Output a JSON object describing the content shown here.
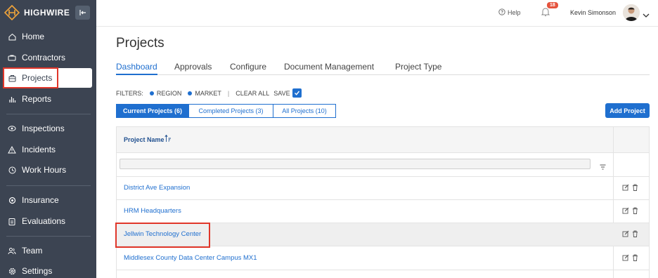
{
  "app": {
    "brand": "HIGHWIRE"
  },
  "sidebar": {
    "items": [
      {
        "label": "Home",
        "icon": "home-icon"
      },
      {
        "label": "Contractors",
        "icon": "contractors-icon"
      },
      {
        "label": "Projects",
        "icon": "projects-icon",
        "active": true
      },
      {
        "label": "Reports",
        "icon": "reports-icon"
      },
      {
        "label": "Inspections",
        "icon": "inspections-icon"
      },
      {
        "label": "Incidents",
        "icon": "incidents-icon"
      },
      {
        "label": "Work Hours",
        "icon": "work-hours-icon"
      },
      {
        "label": "Insurance",
        "icon": "insurance-icon"
      },
      {
        "label": "Evaluations",
        "icon": "evaluations-icon"
      },
      {
        "label": "Team",
        "icon": "team-icon"
      },
      {
        "label": "Settings",
        "icon": "settings-icon"
      }
    ]
  },
  "topbar": {
    "help_label": "Help",
    "notification_count": "18",
    "user_name": "Kevin Simonson"
  },
  "main": {
    "title": "Projects",
    "tabs": [
      {
        "label": "Dashboard",
        "active": true
      },
      {
        "label": "Approvals"
      },
      {
        "label": "Configure"
      },
      {
        "label": "Document Management"
      },
      {
        "label": "Project Type"
      }
    ],
    "filters": {
      "label": "FILTERS:",
      "region": "REGION",
      "market": "MARKET",
      "separator": "|",
      "clear_all": "CLEAR ALL",
      "save": "SAVE"
    },
    "segments": [
      {
        "label": "Current Projects (6)",
        "active": true
      },
      {
        "label": "Completed Projects (3)"
      },
      {
        "label": "All Projects (10)"
      }
    ],
    "add_project_label": "Add Project",
    "table": {
      "column_header": "Project Name",
      "filter_placeholder": "",
      "rows": [
        {
          "name": "District Ave Expansion"
        },
        {
          "name": "HRM Headquarters"
        },
        {
          "name": "Jellwin Technology Center",
          "selected": true
        },
        {
          "name": "Middlesex County Data Center Campus MX1"
        }
      ]
    }
  },
  "colors": {
    "sidebar_bg": "#3c4452",
    "accent": "#1f6fcf",
    "highlight": "#e0362a",
    "badge": "#e5533d"
  }
}
